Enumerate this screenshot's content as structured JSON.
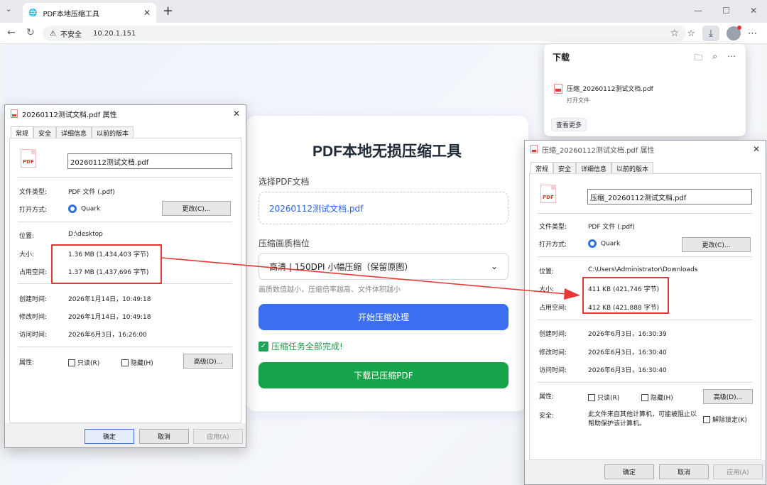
{
  "browser": {
    "tab_title": "PDF本地压缩工具",
    "insecure_label": "不安全",
    "url": "10.20.1.151"
  },
  "tool": {
    "title": "PDF本地无损压缩工具",
    "select_label": "选择PDF文档",
    "selected_file": "20260112测试文档.pdf",
    "quality_label": "压缩画质档位",
    "quality_value": "高清 | 150DPI 小幅压缩（保留原图）",
    "hint": "画质数值越小，压缩倍率越高、文件体积越小",
    "start_button": "开始压缩处理",
    "done_message": "压缩任务全部完成!",
    "download_button": "下载已压缩PDF"
  },
  "downloads": {
    "title": "下载",
    "file": "压缩_20260112测试文档.pdf",
    "open_label": "打开文件",
    "more_label": "查看更多"
  },
  "tabs": [
    "常规",
    "安全",
    "详细信息",
    "以前的版本"
  ],
  "labels": {
    "type": "文件类型:",
    "open_with": "打开方式:",
    "location": "位置:",
    "size": "大小:",
    "disk_size": "占用空间:",
    "created": "创建时间:",
    "modified": "修改时间:",
    "accessed": "访问时间:",
    "attributes": "属性:",
    "security": "安全:",
    "change": "更改(C)...",
    "readonly": "只读(R)",
    "hidden": "隐藏(H)",
    "advanced": "高级(D)...",
    "unblock": "解除锁定(K)",
    "ok": "确定",
    "cancel": "取消",
    "apply": "应用(A)"
  },
  "dialog_left": {
    "title": "20260112测试文档.pdf 属性",
    "filename": "20260112测试文档.pdf",
    "type": "PDF 文件 (.pdf)",
    "app": "Quark",
    "location": "D:\\desktop",
    "size": "1.36 MB (1,434,403 字节)",
    "disk_size": "1.37 MB (1,437,696 字节)",
    "created": "2026年1月14日，10:49:18",
    "modified": "2026年1月14日，10:49:18",
    "accessed": "2026年6月3日，16:26:00"
  },
  "dialog_right": {
    "title": "压缩_20260112测试文档.pdf 属性",
    "filename": "压缩_20260112测试文档.pdf",
    "type": "PDF 文件 (.pdf)",
    "app": "Quark",
    "location": "C:\\Users\\Administrator\\Downloads",
    "size": "411 KB (421,746 字节)",
    "disk_size": "412 KB (421,888 字节)",
    "created": "2026年6月3日，16:30:39",
    "modified": "2026年6月3日，16:30:40",
    "accessed": "2026年6月3日，16:30:40",
    "security_note": "此文件来自其他计算机，可能被阻止以帮助保护该计算机。"
  },
  "colors": {
    "accent_blue": "#3b6ff0",
    "success_green": "#17a34a",
    "highlight_red": "#e53935"
  }
}
